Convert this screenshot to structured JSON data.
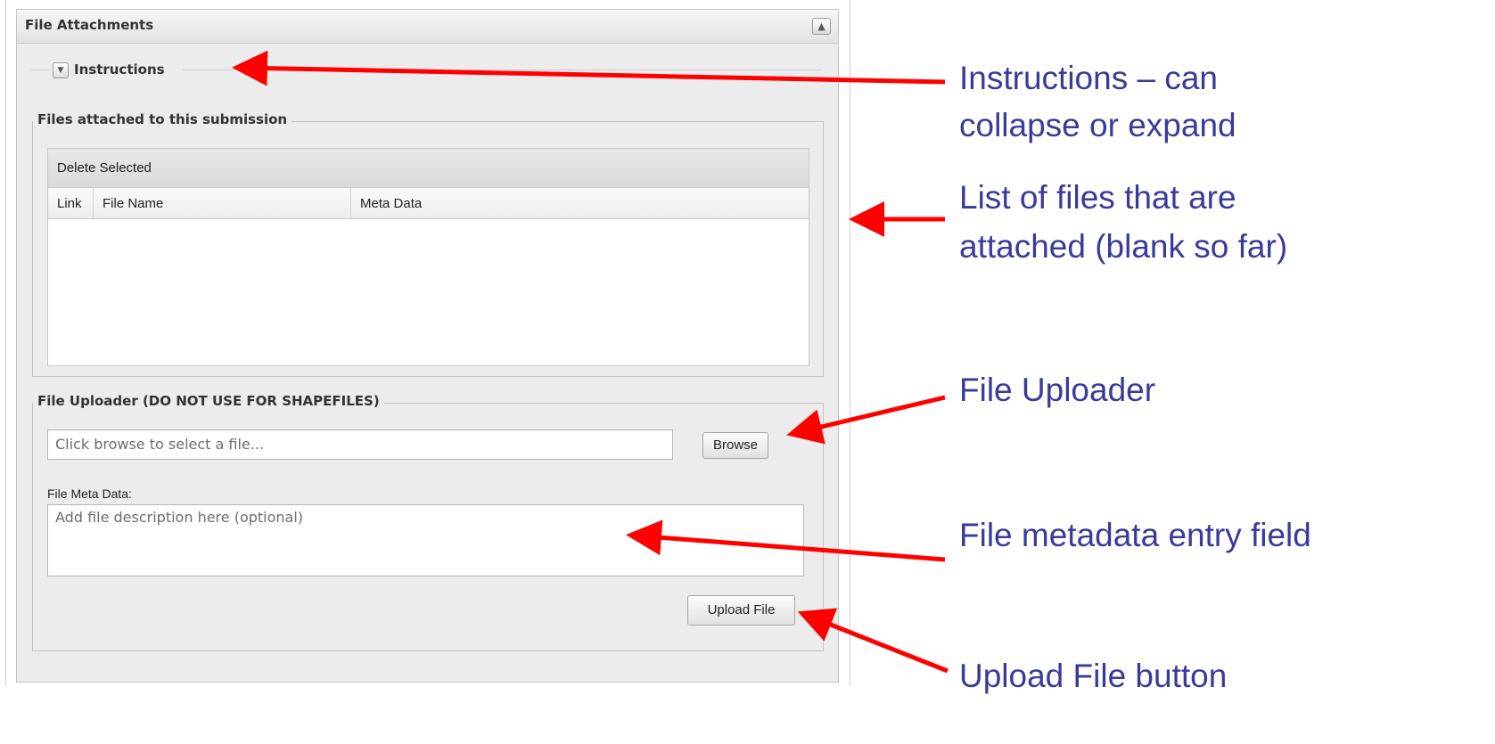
{
  "panel": {
    "title": "File Attachments",
    "collapse_icon": "triangle-up-icon"
  },
  "instructions": {
    "label": "Instructions",
    "toggle_icon": "triangle-down-icon"
  },
  "attached_files": {
    "legend": "Files attached to this submission",
    "toolbar": {
      "delete_selected": "Delete Selected"
    },
    "columns": [
      "Link",
      "File Name",
      "Meta Data"
    ],
    "rows": []
  },
  "uploader": {
    "legend": "File Uploader (DO NOT USE FOR SHAPEFILES)",
    "file_input_placeholder": "Click browse to select a file...",
    "browse_label": "Browse",
    "meta_label": "File Meta Data:",
    "meta_placeholder": "Add file description here (optional)",
    "upload_label": "Upload File"
  },
  "annotations": {
    "instructions_line1": "Instructions – can",
    "instructions_line2": "collapse or expand",
    "list_line1": "List of files that are",
    "list_line2": "attached (blank so far)",
    "uploader": "File Uploader",
    "metadata": "File metadata entry field",
    "upload_button": "Upload File button",
    "arrow_color": "#ff0000",
    "text_color": "#3a3a9a"
  }
}
